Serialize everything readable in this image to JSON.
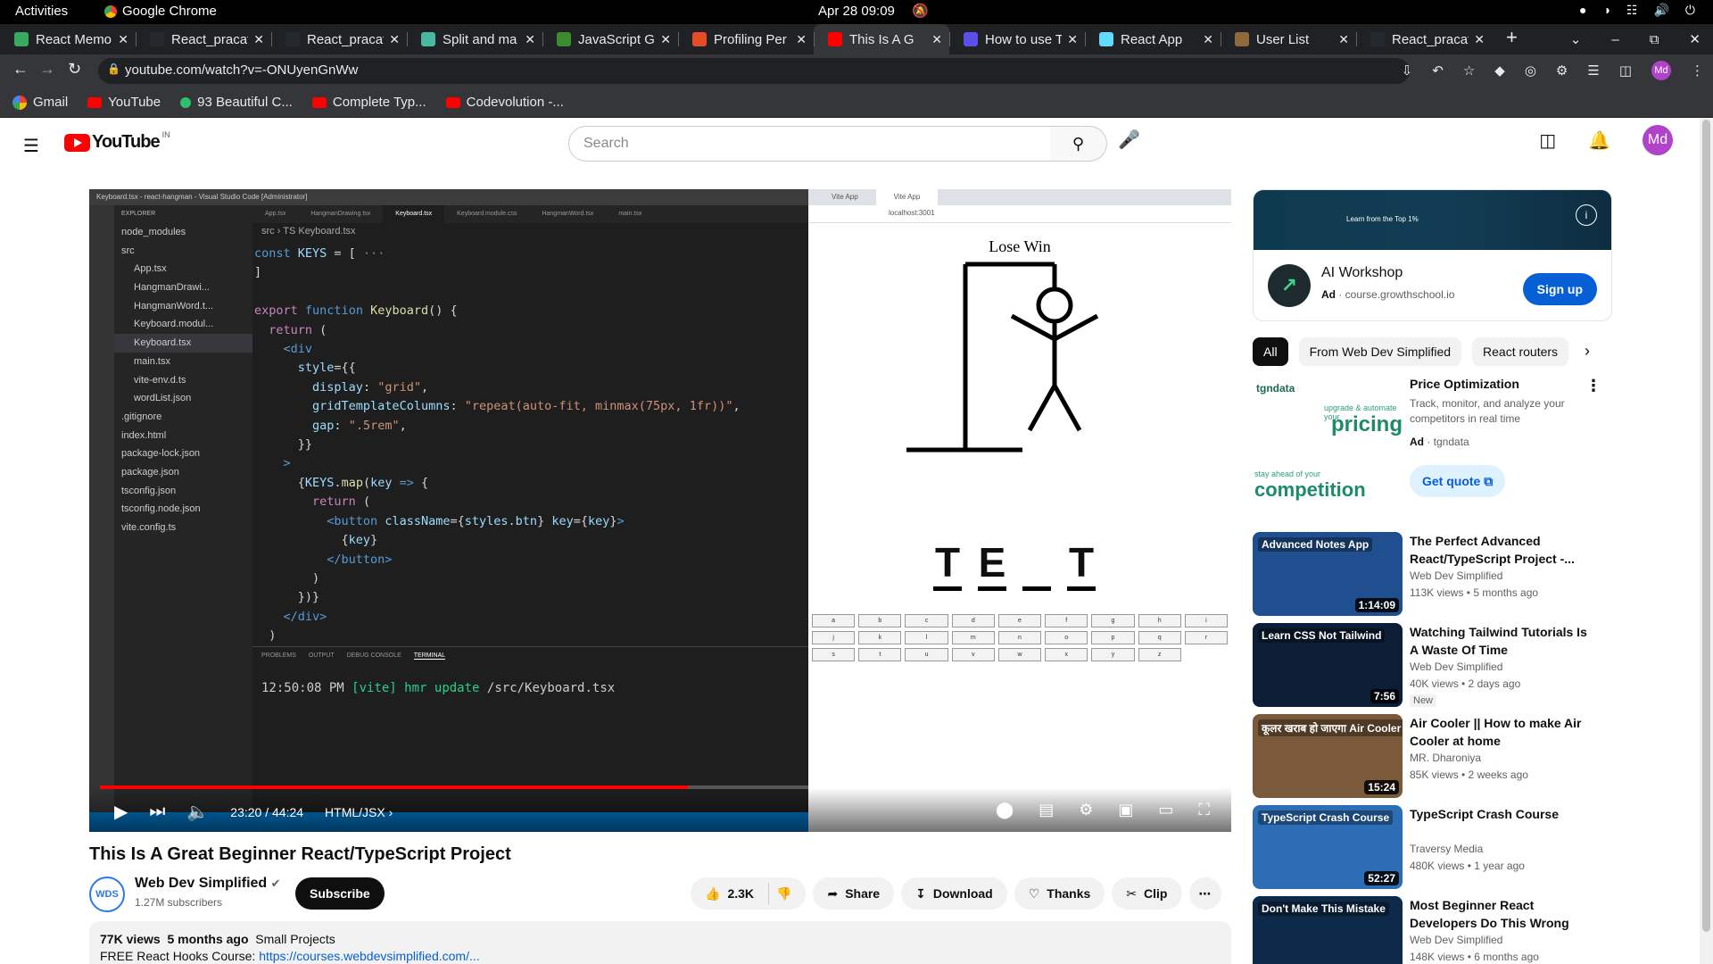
{
  "system": {
    "activities": "Activities",
    "app_name": "Google Chrome",
    "clock": "Apr 28  09:09"
  },
  "tabs": [
    {
      "title": "React Memo",
      "color": "#39a860",
      "active": false
    },
    {
      "title": "React_pracat",
      "color": "#24292f",
      "active": false
    },
    {
      "title": "React_pracat",
      "color": "#24292f",
      "active": false
    },
    {
      "title": "Split and ma",
      "color": "#4ab7a0",
      "active": false
    },
    {
      "title": "JavaScript G",
      "color": "#3c8d2f",
      "active": false
    },
    {
      "title": "Profiling Per",
      "color": "#e34c26",
      "active": false
    },
    {
      "title": "This Is A G",
      "color": "#ff0000",
      "active": true
    },
    {
      "title": "How to use T",
      "color": "#5b4fe9",
      "active": false
    },
    {
      "title": "React App",
      "color": "#61dafb",
      "active": false
    },
    {
      "title": "User List",
      "color": "#8e6b3a",
      "active": false
    },
    {
      "title": "React_pracat",
      "color": "#24292f",
      "active": false
    }
  ],
  "url": "youtube.com/watch?v=-ONUyenGnWw",
  "bookmarks": [
    "Gmail",
    "YouTube",
    "93 Beautiful C...",
    "Complete Typ...",
    "Codevolution -..."
  ],
  "youtube": {
    "logo_text": "YouTube",
    "country": "IN",
    "search_placeholder": "Search",
    "avatar": "Md"
  },
  "vscode": {
    "window_title": "Keyboard.tsx - react-hangman - Visual Studio Code [Administrator]",
    "explorer_label": "EXPLORER",
    "files": [
      "node_modules",
      "src",
      "App.tsx",
      "HangmanDrawi...",
      "HangmanWord.t...",
      "Keyboard.modul...",
      "Keyboard.tsx",
      "main.tsx",
      "vite-env.d.ts",
      "wordList.json",
      ".gitignore",
      "index.html",
      "package-lock.json",
      "package.json",
      "tsconfig.json",
      "tsconfig.node.json",
      "vite.config.ts"
    ],
    "tabs": [
      "App.tsx",
      "HangmanDrawing.tsx",
      "Keyboard.tsx",
      "Keyboard.module.css",
      "HangmanWord.tsx",
      "main.tsx"
    ],
    "breadcrumb": "src  ›  TS  Keyboard.tsx",
    "panel_tabs": [
      "PROBLEMS",
      "OUTPUT",
      "DEBUG CONSOLE",
      "TERMINAL"
    ],
    "terminal_time": "12:50:08 PM",
    "terminal_tag": "[vite]",
    "terminal_msg": "hmr update",
    "terminal_path": "/src/Keyboard.tsx"
  },
  "hangman": {
    "tabs": [
      "Vite App",
      "Vite App"
    ],
    "url": "localhost:3001",
    "heading": "Lose Win",
    "letters": [
      "T",
      "E",
      "",
      "T"
    ],
    "keys": [
      "a",
      "b",
      "c",
      "d",
      "e",
      "f",
      "g",
      "h",
      "i",
      "j",
      "k",
      "l",
      "m",
      "n",
      "o",
      "p",
      "q",
      "r",
      "s",
      "t",
      "u",
      "v",
      "w",
      "x",
      "y",
      "z"
    ]
  },
  "player": {
    "time": "23:20 / 44:24",
    "chapter": "HTML/JSX",
    "played_fraction": 0.525,
    "buffered_fraction": 0.51
  },
  "video": {
    "title": "This Is A Great Beginner React/TypeScript Project",
    "channel": "Web Dev Simplified",
    "channel_avatar": "WDS",
    "subscribers": "1.27M subscribers",
    "subscribe_label": "Subscribe",
    "likes": "2.3K",
    "share": "Share",
    "download": "Download",
    "thanks": "Thanks",
    "clip": "Clip",
    "views": "77K views",
    "age": "5 months ago",
    "category": "Small Projects",
    "desc_prefix": "FREE React Hooks Course:",
    "desc_link": "https://courses.webdevsimplified.com/..."
  },
  "ad": {
    "banner_text": "Learn from the Top 1%",
    "title": "AI Workshop",
    "ad_label": "Ad",
    "domain": "course.growthschool.io",
    "cta": "Sign up"
  },
  "chips": [
    "All",
    "From Web Dev Simplified",
    "React routers"
  ],
  "sponsored": {
    "brand": "tgndata",
    "line1": "upgrade & automate your",
    "line1_big": "pricing",
    "line2": "stay ahead of your",
    "line2_big": "competition",
    "title": "Price Optimization",
    "desc": "Track, monitor, and analyze your competitors in real time",
    "ad_label": "Ad",
    "advertiser": "tgndata",
    "cta": "Get quote"
  },
  "recommendations": [
    {
      "title": "The Perfect Advanced React/TypeScript Project -...",
      "channel": "Web Dev Simplified",
      "meta": "113K views  •  5 months ago",
      "duration": "1:14:09",
      "thumb_text": "Advanced Notes App",
      "thumb_color": "#1f4f8f",
      "badge": ""
    },
    {
      "title": "Watching Tailwind Tutorials Is A Waste Of Time",
      "channel": "Web Dev Simplified",
      "meta": "40K views  •  2 days ago",
      "duration": "7:56",
      "thumb_text": "Learn CSS Not Tailwind",
      "thumb_color": "#0b1e36",
      "badge": "New"
    },
    {
      "title": "Air Cooler || How to make Air Cooler at home",
      "channel": "MR. Dharoniya",
      "meta": "85K views  •  2 weeks ago",
      "duration": "15:24",
      "thumb_text": "कूलर खराब हो जाएगा Air Cooler",
      "thumb_color": "#7a5a3a",
      "badge": ""
    },
    {
      "title": "TypeScript Crash Course",
      "channel": "Traversy Media",
      "meta": "480K views  •  1 year ago",
      "duration": "52:27",
      "thumb_text": "TypeScript Crash Course",
      "thumb_color": "#2d6db5",
      "badge": ""
    },
    {
      "title": "Most Beginner React Developers Do This Wrong",
      "channel": "Web Dev Simplified",
      "meta": "148K views  •  6 months ago",
      "duration": "",
      "thumb_text": "Don't Make This Mistake",
      "thumb_color": "#0e2a4a",
      "badge": ""
    }
  ]
}
